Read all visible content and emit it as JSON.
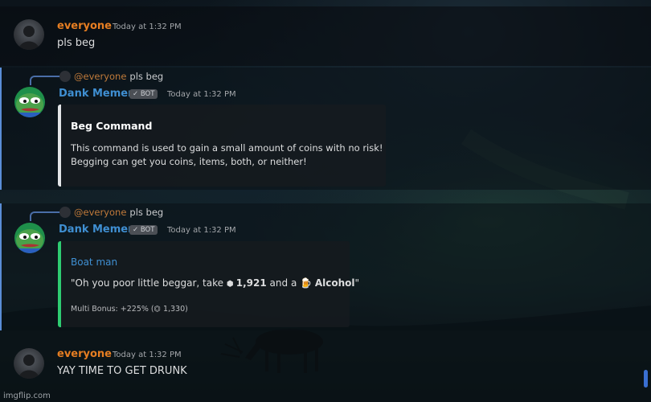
{
  "messages": [
    {
      "author": "everyone",
      "timestamp": "Today at 1:32 PM",
      "text": "pls beg"
    },
    {
      "reply": {
        "mention": "@everyone",
        "text": "pls beg"
      },
      "author": "Dank Memer",
      "badge": "✓ BOT",
      "timestamp": "Today at 1:32 PM",
      "embed": {
        "title": "Beg Command",
        "lines": [
          "This command is used to gain a small amount of coins with no risk!",
          "Begging can get you coins, items, both, or neither!"
        ]
      }
    },
    {
      "reply": {
        "mention": "@everyone",
        "text": "pls beg"
      },
      "author": "Dank Memer",
      "badge": "✓ BOT",
      "timestamp": "Today at 1:32 PM",
      "embed": {
        "title": "Boat man",
        "quote_prefix": "\"Oh you poor little beggar, take ",
        "coin_amount": "1,921",
        "quote_mid": " and a ",
        "item": "Alcohol",
        "quote_suffix": "\"",
        "footer": "Multi Bonus: +225% (⏣ 1,330)"
      }
    },
    {
      "author": "everyone",
      "timestamp": "Today at 1:32 PM",
      "text": "YAY TIME TO GET DRUNK"
    }
  ],
  "colors": {
    "user_name": "#e67e22",
    "bot_name": "#3f8fd2",
    "embed1_bar": "#e3e5e8",
    "embed2_bar": "#2ecc71",
    "link": "#3f8fd2"
  },
  "icons": {
    "coin": "coin-icon",
    "beer": "beer-icon",
    "check": "check-icon"
  },
  "watermark": "imgflip.com"
}
